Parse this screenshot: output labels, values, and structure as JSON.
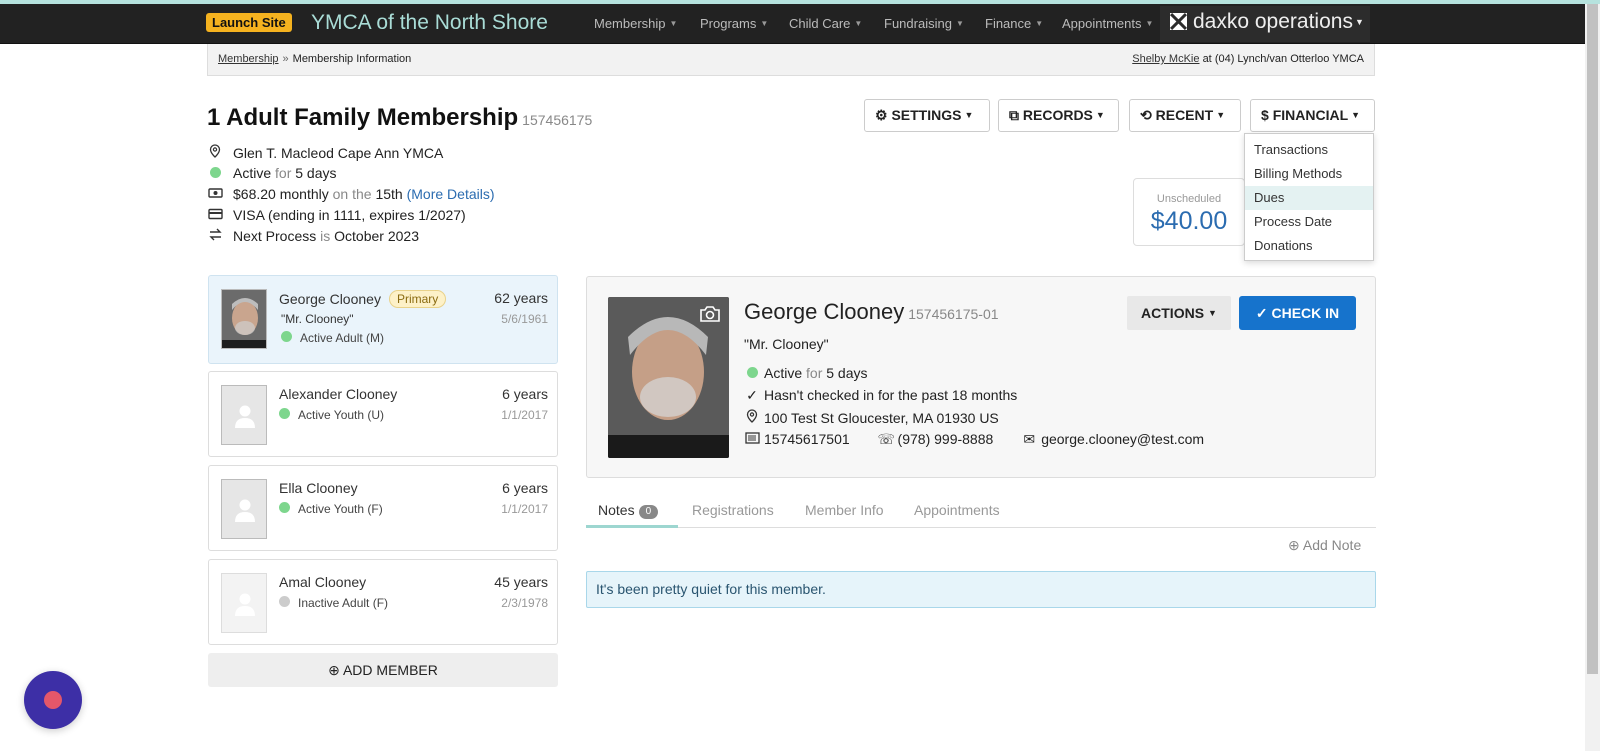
{
  "header": {
    "launch_label": "Launch Site",
    "org_name": "YMCA of the North Shore",
    "nav": [
      {
        "label": "Membership"
      },
      {
        "label": "Programs"
      },
      {
        "label": "Child Care"
      },
      {
        "label": "Fundraising"
      },
      {
        "label": "Finance"
      },
      {
        "label": "Appointments"
      }
    ],
    "brand": "daxko operations",
    "accent_color": "#b6e3de",
    "launch_color": "#f5b21f"
  },
  "breadcrumb": {
    "root": "Membership",
    "separator": "»",
    "current": "Membership Information",
    "user": "Shelby McKie",
    "location_prefix": "at",
    "location": "(04) Lynch/van Otterloo YMCA"
  },
  "membership": {
    "title": "1 Adult Family Membership",
    "number": "157456175",
    "branch": "Glen T. Macleod Cape Ann YMCA",
    "status": "Active",
    "for_word": "for",
    "status_duration": "5 days",
    "price": "$68.20 monthly",
    "on_the": "on the",
    "billing_day": "15th",
    "more_details": "(More Details)",
    "card": "VISA (ending in 1111, expires 1/2027)",
    "next_label": "Next Process",
    "is_word": "is",
    "next_process": "October 2023"
  },
  "toolbar": {
    "settings": "SETTINGS",
    "records": "RECORDS",
    "recent": "RECENT",
    "financial": "FINANCIAL"
  },
  "financial_menu": {
    "items": [
      "Transactions",
      "Billing Methods",
      "Dues",
      "Process Date",
      "Donations"
    ],
    "highlighted": "Dues"
  },
  "balance": {
    "label": "Unscheduled",
    "amount": "$40.00"
  },
  "members": [
    {
      "name": "George Clooney",
      "badge": "Primary",
      "nickname": "\"Mr. Clooney\"",
      "status": "Active Adult (M)",
      "age": "62 years",
      "dob": "5/6/1961",
      "active": true
    },
    {
      "name": "Alexander Clooney",
      "status": "Active Youth (U)",
      "age": "6 years",
      "dob": "1/1/2017",
      "active": true
    },
    {
      "name": "Ella Clooney",
      "status": "Active Youth (F)",
      "age": "6 years",
      "dob": "1/1/2017",
      "active": true
    },
    {
      "name": "Amal Clooney",
      "status": "Inactive Adult (F)",
      "age": "45 years",
      "dob": "2/3/1978",
      "active": false
    }
  ],
  "add_member": "ADD MEMBER",
  "detail": {
    "name": "George Clooney",
    "number": "157456175-01",
    "nickname": "\"Mr. Clooney\"",
    "status": "Active",
    "for_word": "for",
    "status_duration": "5 days",
    "checkin_note": "Hasn't checked in for the past 18 months",
    "address": "100 Test St Gloucester, MA 01930 US",
    "barcode": "15745617501",
    "phone": "(978) 999-8888",
    "email": "george.clooney@test.com",
    "actions_label": "ACTIONS",
    "checkin_label": "CHECK IN"
  },
  "tabs": {
    "notes": "Notes",
    "notes_count": "0",
    "registrations": "Registrations",
    "member_info": "Member Info",
    "appointments": "Appointments"
  },
  "add_note": "Add Note",
  "empty_message": "It's been pretty quiet for this member."
}
